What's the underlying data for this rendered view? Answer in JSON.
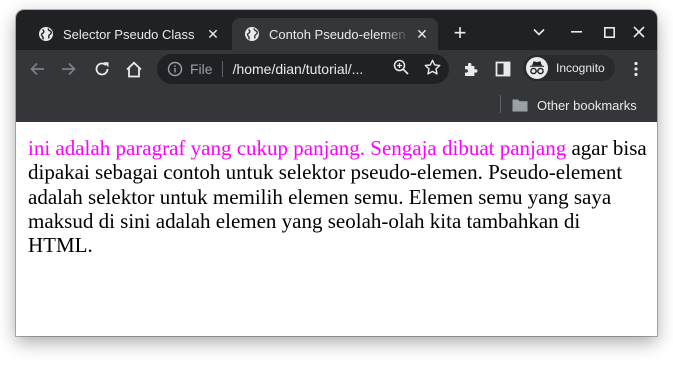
{
  "tabs": [
    {
      "title": "Selector Pseudo Class",
      "active": false
    },
    {
      "title": "Contoh Pseudo-elemen",
      "active": true
    }
  ],
  "toolbar": {
    "scheme": "File",
    "url": "/home/dian/tutorial/...",
    "incognito_label": "Incognito"
  },
  "bookmarks": {
    "other_label": "Other bookmarks"
  },
  "page": {
    "first_line": "ini adalah paragraf yang cukup panjang. Sengaja dibuat panjang",
    "rest": "agar bisa dipakai sebagai contoh untuk selektor pseudo-elemen. Pseudo-element adalah selektor untuk memilih elemen semu. Elemen semu yang saya maksud di sini adalah elemen yang seolah-olah kita tambahkan di HTML.",
    "first_line_color": "#ff00ff"
  },
  "colors": {
    "titlebar": "#202124",
    "toolbar": "#35363a",
    "text_light": "#e8eaed"
  }
}
